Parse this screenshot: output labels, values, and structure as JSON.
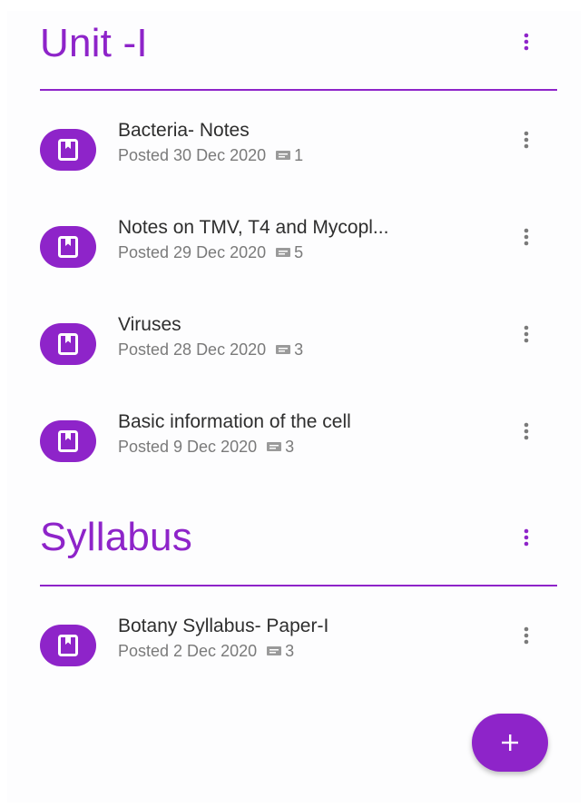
{
  "accent_color": "#8e24c9",
  "topics": [
    {
      "title": "Unit -I",
      "items": [
        {
          "title": "Bacteria- Notes",
          "posted": "Posted 30 Dec 2020",
          "comments": "1",
          "icon": "assignment-book-icon"
        },
        {
          "title": "Notes on TMV, T4 and Mycopl...",
          "posted": "Posted 29 Dec 2020",
          "comments": "5",
          "icon": "assignment-book-icon"
        },
        {
          "title": "Viruses",
          "posted": "Posted 28 Dec 2020",
          "comments": "3",
          "icon": "assignment-book-icon"
        },
        {
          "title": "Basic information of the cell",
          "posted": "Posted 9 Dec 2020",
          "comments": "3",
          "icon": "assignment-book-icon"
        }
      ]
    },
    {
      "title": "Syllabus",
      "items": [
        {
          "title": "Botany Syllabus- Paper-I",
          "posted": "Posted 2 Dec 2020",
          "comments": "3",
          "icon": "assignment-book-icon"
        }
      ]
    }
  ],
  "fab": {
    "icon": "plus-icon"
  }
}
